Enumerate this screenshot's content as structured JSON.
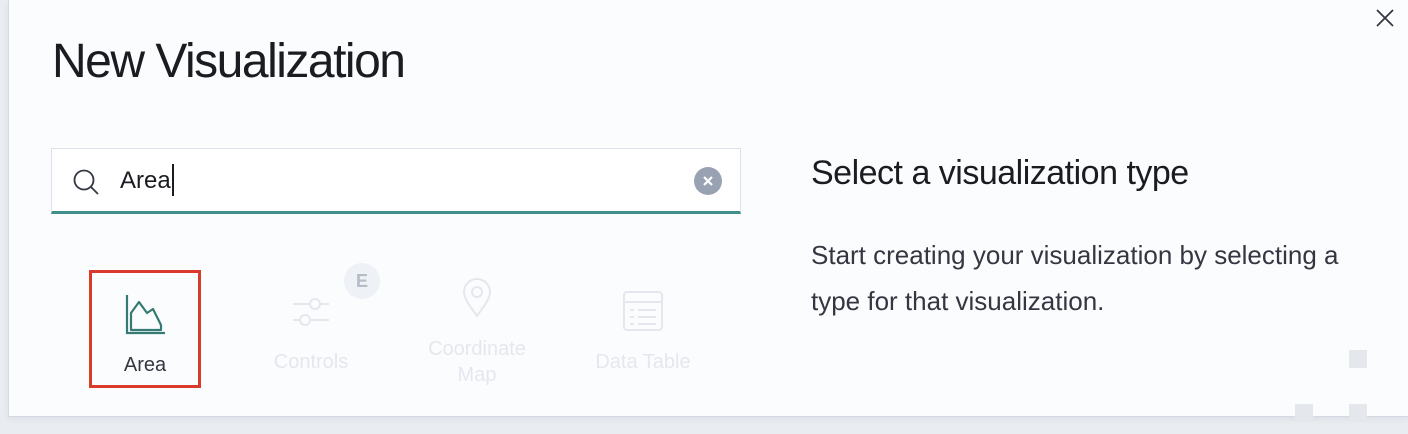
{
  "modal": {
    "title": "New Visualization",
    "close_icon": "close-icon"
  },
  "search": {
    "value": "Area",
    "search_icon": "search-icon",
    "clear_icon": "clear-icon"
  },
  "types": [
    {
      "label": "Area",
      "icon": "area-chart-icon",
      "selected": true
    },
    {
      "label": "Controls",
      "icon": "controls-icon",
      "selected": false,
      "badge": "E"
    },
    {
      "label": "Coordinate Map",
      "icon": "map-pin-icon",
      "selected": false
    },
    {
      "label": "Data Table",
      "icon": "table-icon",
      "selected": false
    }
  ],
  "side_panel": {
    "title": "Select a visualization type",
    "description": "Start creating your visualization by selecting a type for that visualization."
  },
  "colors": {
    "accent": "#3f8f8c",
    "selection_border": "#d93a2b",
    "area_icon": "#357b73"
  }
}
